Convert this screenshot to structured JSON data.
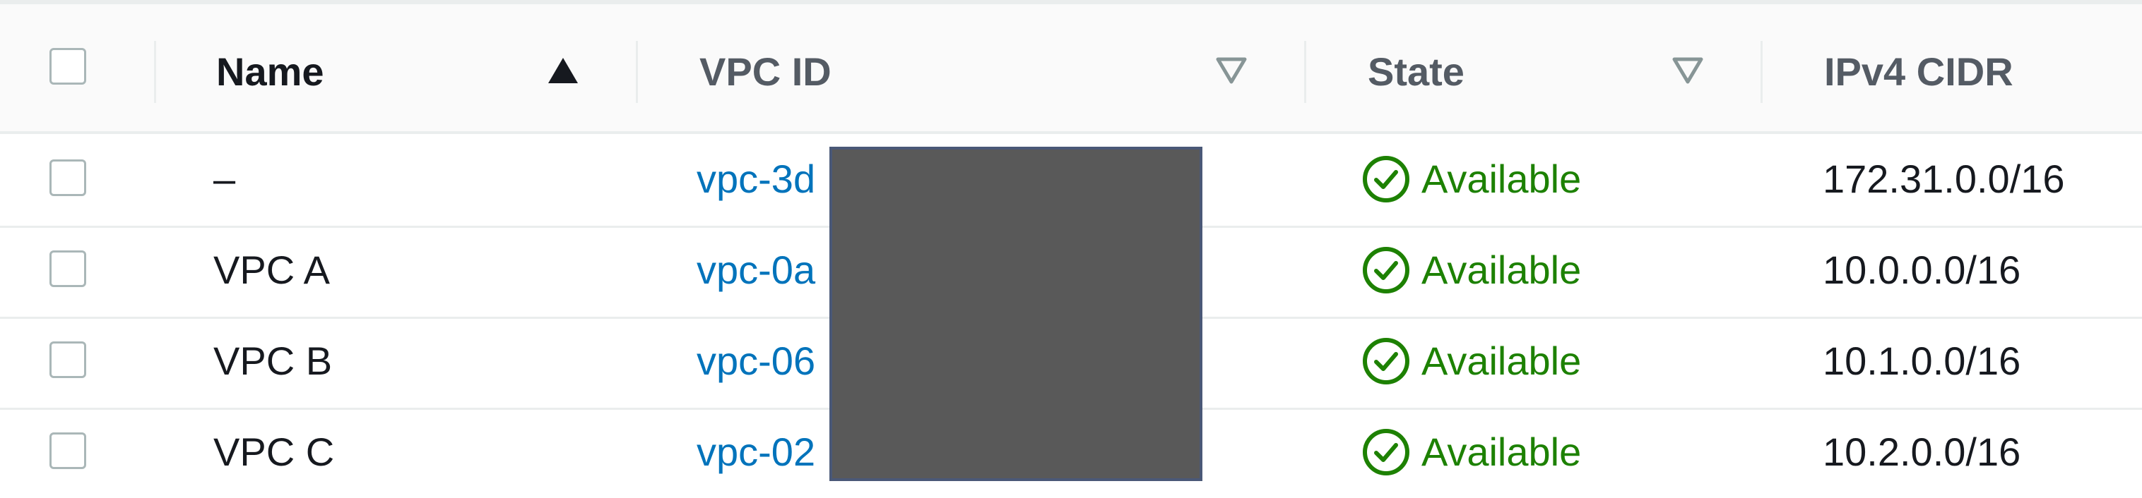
{
  "table": {
    "columns": [
      {
        "key": "select",
        "label": ""
      },
      {
        "key": "name",
        "label": "Name",
        "sort": "ascending"
      },
      {
        "key": "vpc_id",
        "label": "VPC ID",
        "sort": "none"
      },
      {
        "key": "state",
        "label": "State",
        "sort": "none"
      },
      {
        "key": "ipv4_cidr",
        "label": "IPv4 CIDR"
      }
    ],
    "rows": [
      {
        "name": "–",
        "vpc_id": "vpc-3d",
        "state": "Available",
        "ipv4_cidr": "172.31.0.0/16"
      },
      {
        "name": "VPC A",
        "vpc_id": "vpc-0a",
        "state": "Available",
        "ipv4_cidr": "10.0.0.0/16"
      },
      {
        "name": "VPC B",
        "vpc_id": "vpc-06",
        "state": "Available",
        "ipv4_cidr": "10.1.0.0/16"
      },
      {
        "name": "VPC C",
        "vpc_id": "vpc-02",
        "state": "Available",
        "ipv4_cidr": "10.2.0.0/16"
      }
    ]
  },
  "colors": {
    "link": "#0073bb",
    "status_available": "#1d8102",
    "header_background": "#fafafa",
    "redaction": "#595959"
  },
  "icons": {
    "sort_ascending": "caret-up-filled-icon",
    "sort_none": "caret-down-outline-icon",
    "status_available": "check-circle-icon"
  }
}
